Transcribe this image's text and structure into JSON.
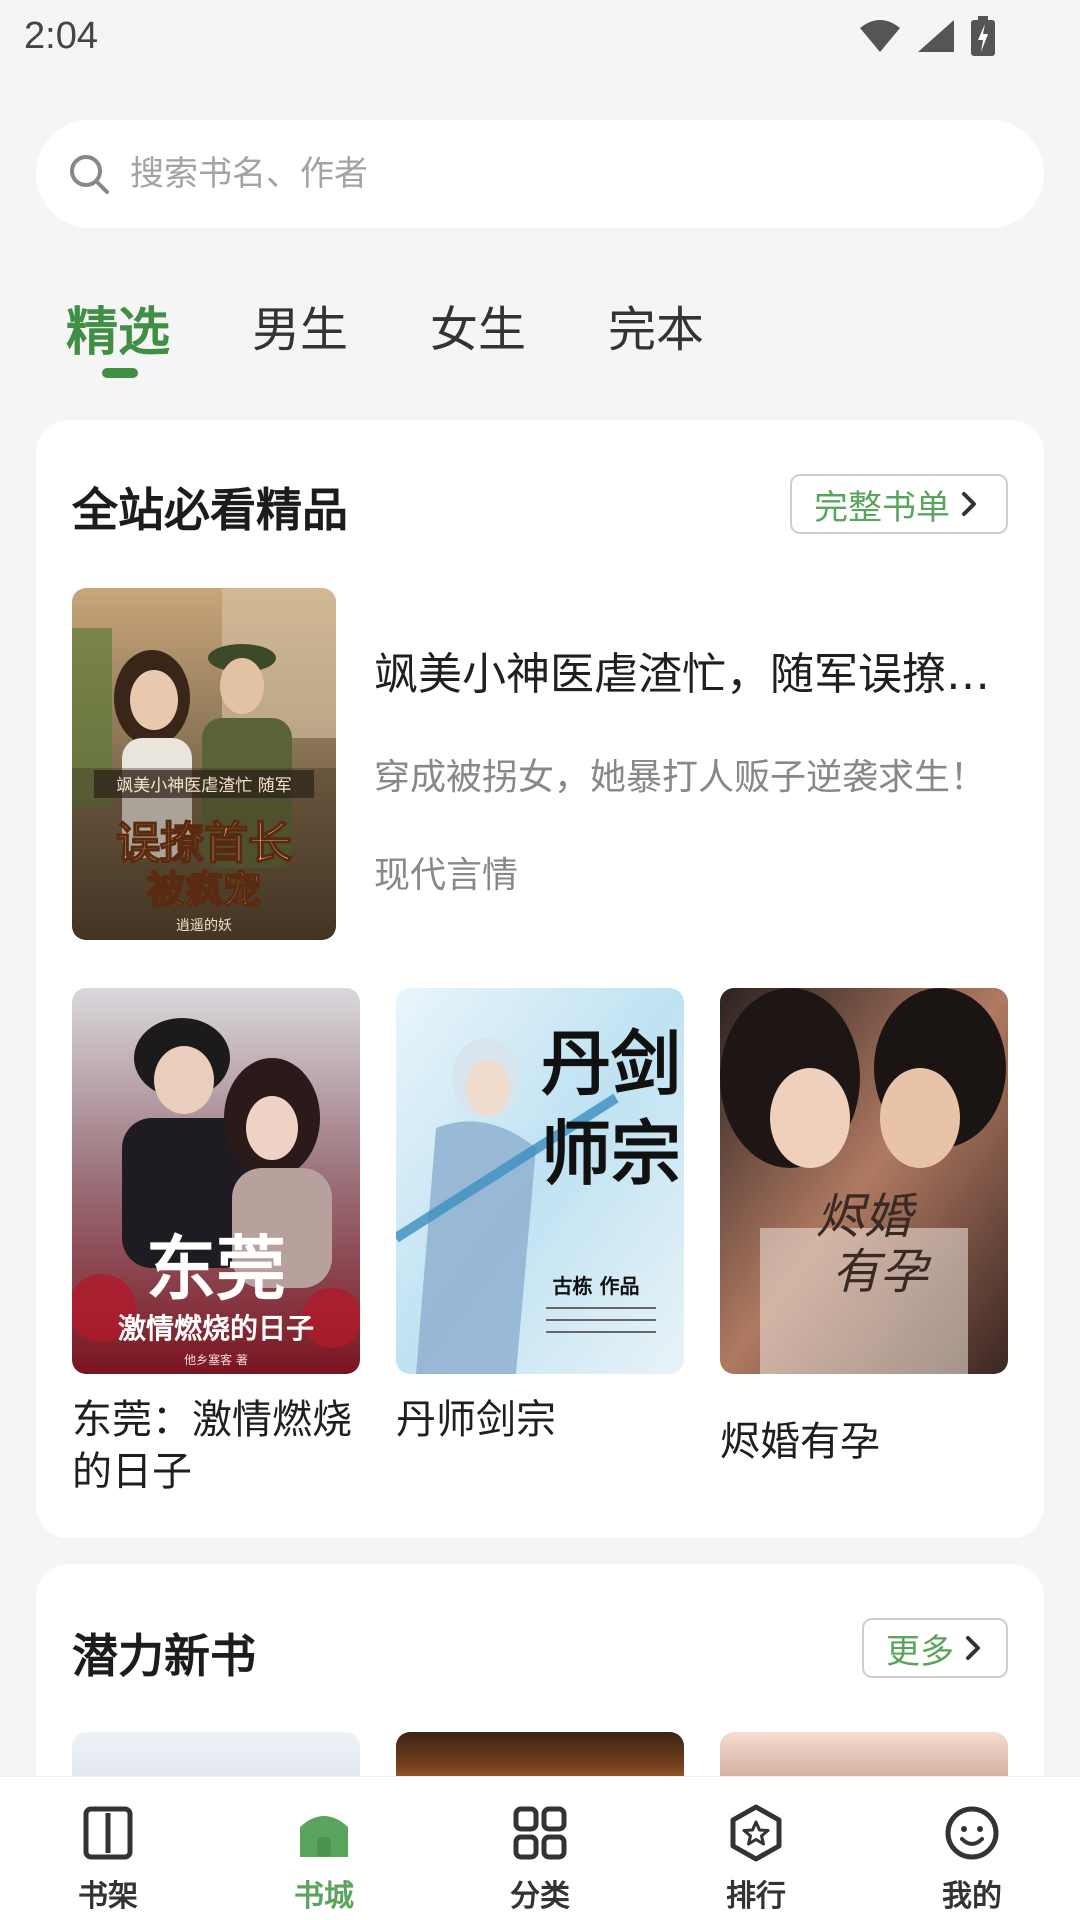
{
  "status_bar": {
    "time": "2:04"
  },
  "search": {
    "placeholder": "搜索书名、作者"
  },
  "tabs": [
    {
      "label": "精选",
      "active": true
    },
    {
      "label": "男生",
      "active": false
    },
    {
      "label": "女生",
      "active": false
    },
    {
      "label": "完本",
      "active": false
    }
  ],
  "section_featured": {
    "title": "全站必看精品",
    "more_label": "完整书单",
    "featured_book": {
      "title": "飒美小神医虐渣忙，随军误撩首长被疯宠",
      "description": "穿成被拐女，她暴打人贩子逆袭求生！",
      "genre": "现代言情",
      "cover_text_top": "飒美小神医虐渣忙 随军",
      "cover_text_main": "误撩首长被疯宠",
      "cover_author": "逍遥的妖"
    },
    "grid_books": [
      {
        "name": "东莞：激情燃烧的日子",
        "cover_main": "东莞",
        "cover_sub": "激情燃烧的日子",
        "cover_author": "他乡塞客 著"
      },
      {
        "name": "丹师剑宗",
        "cover_main": "丹师剑宗",
        "cover_author": "古栋 作品"
      },
      {
        "name": "烬婚有孕",
        "cover_main": "烬婚有孕"
      }
    ]
  },
  "section_new": {
    "title": "潜力新书",
    "more_label": "更多"
  },
  "bottom_nav": [
    {
      "label": "书架",
      "icon": "book-icon",
      "active": false
    },
    {
      "label": "书城",
      "icon": "store-icon",
      "active": true
    },
    {
      "label": "分类",
      "icon": "grid-icon",
      "active": false
    },
    {
      "label": "排行",
      "icon": "rank-star-icon",
      "active": false
    },
    {
      "label": "我的",
      "icon": "smile-face-icon",
      "active": false
    }
  ],
  "colors": {
    "accent": "#3f8f45",
    "accent_light": "#5aa55e",
    "background": "#f5f5f5"
  }
}
